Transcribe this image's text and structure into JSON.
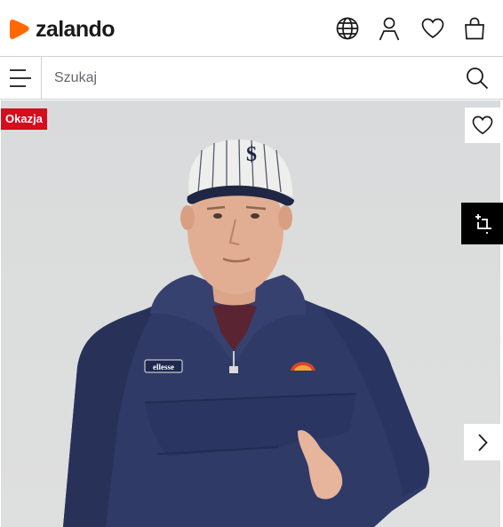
{
  "brand": {
    "name": "zalando",
    "accent_color": "#ff6900"
  },
  "header": {
    "icons": [
      "globe-icon",
      "account-icon",
      "wishlist-icon",
      "bag-icon"
    ]
  },
  "search": {
    "placeholder": "Szukaj",
    "value": ""
  },
  "product": {
    "badge": "Okazja",
    "badge_color": "#d50d1c",
    "jacket_brand_label": "ellesse"
  }
}
